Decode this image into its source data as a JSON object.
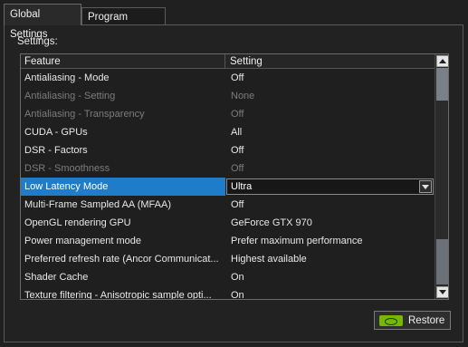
{
  "tabs": [
    {
      "label": "Global Settings",
      "active": true
    },
    {
      "label": "Program Settings",
      "active": false
    }
  ],
  "settings_label": "Settings:",
  "grid": {
    "columns": [
      "Feature",
      "Setting"
    ],
    "rows": [
      {
        "feature": "Antialiasing - Mode",
        "setting": "Off",
        "disabled": false
      },
      {
        "feature": "Antialiasing - Setting",
        "setting": "None",
        "disabled": true
      },
      {
        "feature": "Antialiasing - Transparency",
        "setting": "Off",
        "disabled": true
      },
      {
        "feature": "CUDA - GPUs",
        "setting": "All",
        "disabled": false
      },
      {
        "feature": "DSR - Factors",
        "setting": "Off",
        "disabled": false
      },
      {
        "feature": "DSR - Smoothness",
        "setting": "Off",
        "disabled": true
      },
      {
        "feature": "Low Latency Mode",
        "setting": "Ultra",
        "disabled": false,
        "selected": true
      },
      {
        "feature": "Multi-Frame Sampled AA (MFAA)",
        "setting": "Off",
        "disabled": false
      },
      {
        "feature": "OpenGL rendering GPU",
        "setting": "GeForce GTX 970",
        "disabled": false
      },
      {
        "feature": "Power management mode",
        "setting": "Prefer maximum performance",
        "disabled": false
      },
      {
        "feature": "Preferred refresh rate (Ancor Communicat...",
        "setting": "Highest available",
        "disabled": false
      },
      {
        "feature": "Shader Cache",
        "setting": "On",
        "disabled": false
      },
      {
        "feature": "Texture filtering - Anisotropic sample opti...",
        "setting": "On",
        "disabled": false
      }
    ]
  },
  "restore_label": "Restore",
  "colors": {
    "selection": "#1f7cc8",
    "nvidia_green": "#76b900"
  }
}
